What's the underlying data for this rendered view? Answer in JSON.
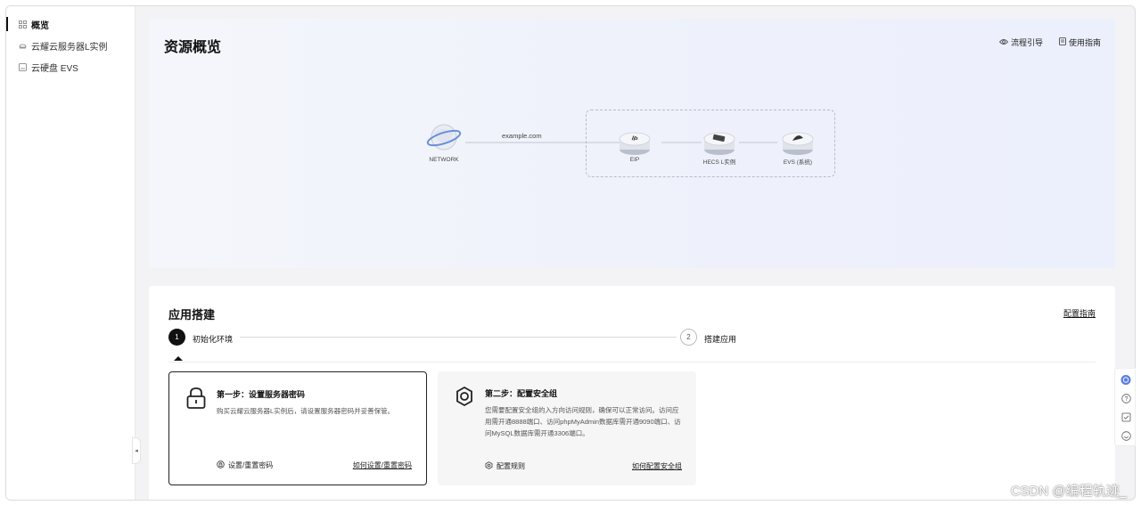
{
  "sidebar": {
    "items": [
      {
        "label": "概览",
        "icon": "grid-icon",
        "active": true
      },
      {
        "label": "云耀云服务器L实例",
        "icon": "cloud-server-icon",
        "active": false
      },
      {
        "label": "云硬盘 EVS",
        "icon": "disk-icon",
        "active": false
      }
    ]
  },
  "overview": {
    "title": "资源概览",
    "links": {
      "flow": "流程引导",
      "guide": "使用指南"
    },
    "diagram": {
      "network_label": "NETWORK",
      "domain_label": "example.com",
      "eip_label": "EIP",
      "hecs_label": "HECS L实例",
      "evs_label": "EVS (系统)"
    }
  },
  "apps": {
    "title": "应用搭建",
    "config_guide": "配置指南",
    "steps": [
      {
        "num": "1",
        "label": "初始化环境"
      },
      {
        "num": "2",
        "label": "搭建应用"
      }
    ],
    "cards": [
      {
        "title": "第一步：设置服务器密码",
        "desc": "购买云耀云服务器L实例后，请设置服务器密码并妥善保管。",
        "action": "设置/重置密码",
        "help": "如何设置/重置密码"
      },
      {
        "title": "第二步：配置安全组",
        "desc": "您需要配置安全组的入方向访问规则，确保可以正常访问。访问应用需开通8888端口、访问phpMyAdmin数据库需开通9090端口、访问MySQL数据库需开通3306端口。",
        "action": "配置规则",
        "help": "如何配置安全组"
      }
    ]
  },
  "watermark": "CSDN @编程轨迹_"
}
